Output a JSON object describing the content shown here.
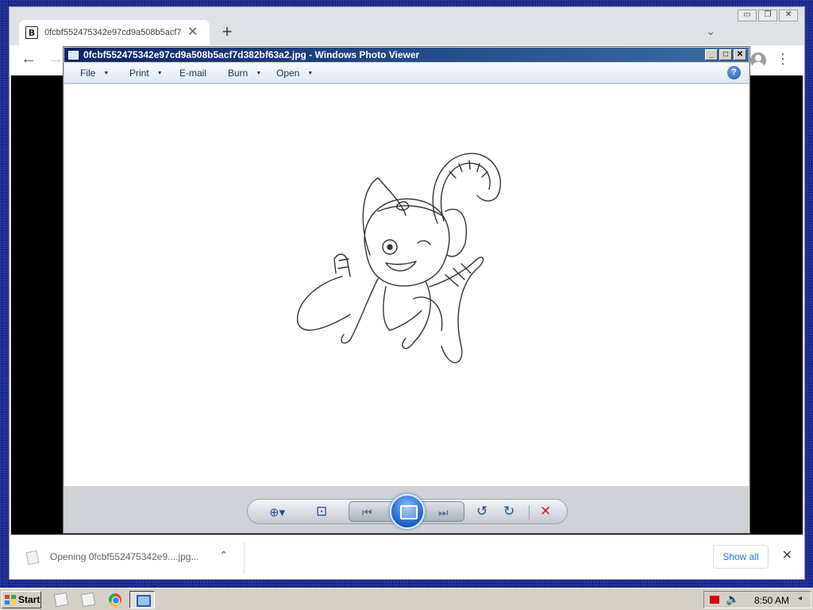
{
  "browser": {
    "tab_title": "0fcbf552475342e97cd9a508b5acf7",
    "tab_favicon": "B",
    "tab_close": "✕",
    "new_tab": "+",
    "tab_search": "⌄",
    "win_minimize": "▭",
    "win_restore": "❐",
    "win_close": "✕",
    "back": "←",
    "forward": "→",
    "menu": "⋮"
  },
  "download_shelf": {
    "item_text": "Opening 0fcbf552475342e9....jpg...",
    "chevron": "⌃",
    "show_all_label": "Show all",
    "close": "✕"
  },
  "photo_viewer": {
    "title": "0fcbf552475342e97cd9a508b5acf7d382bf63a2.jpg - Windows Photo Viewer",
    "controls": {
      "minimize": "_",
      "maximize": "□",
      "close": "✕"
    },
    "menu": [
      {
        "label": "File",
        "caret": "▼"
      },
      {
        "label": "Print",
        "caret": "▼"
      },
      {
        "label": "E-mail",
        "caret": ""
      },
      {
        "label": "Burn",
        "caret": "▼"
      },
      {
        "label": "Open",
        "caret": "▼"
      }
    ],
    "help": "?",
    "toolbar": {
      "zoom": "⊕▾",
      "fit": "⊡",
      "previous": "⏮",
      "next": "⏭",
      "rotate_ccw": "↺",
      "rotate_cw": "↻",
      "delete": "✕"
    },
    "icon_colors": {
      "primary": "#1d4f91",
      "delete": "#c62828"
    }
  },
  "taskbar": {
    "start_label": "Start",
    "clock": "8:50 AM",
    "speaker": "🔈",
    "tray_arrow": "◂"
  }
}
